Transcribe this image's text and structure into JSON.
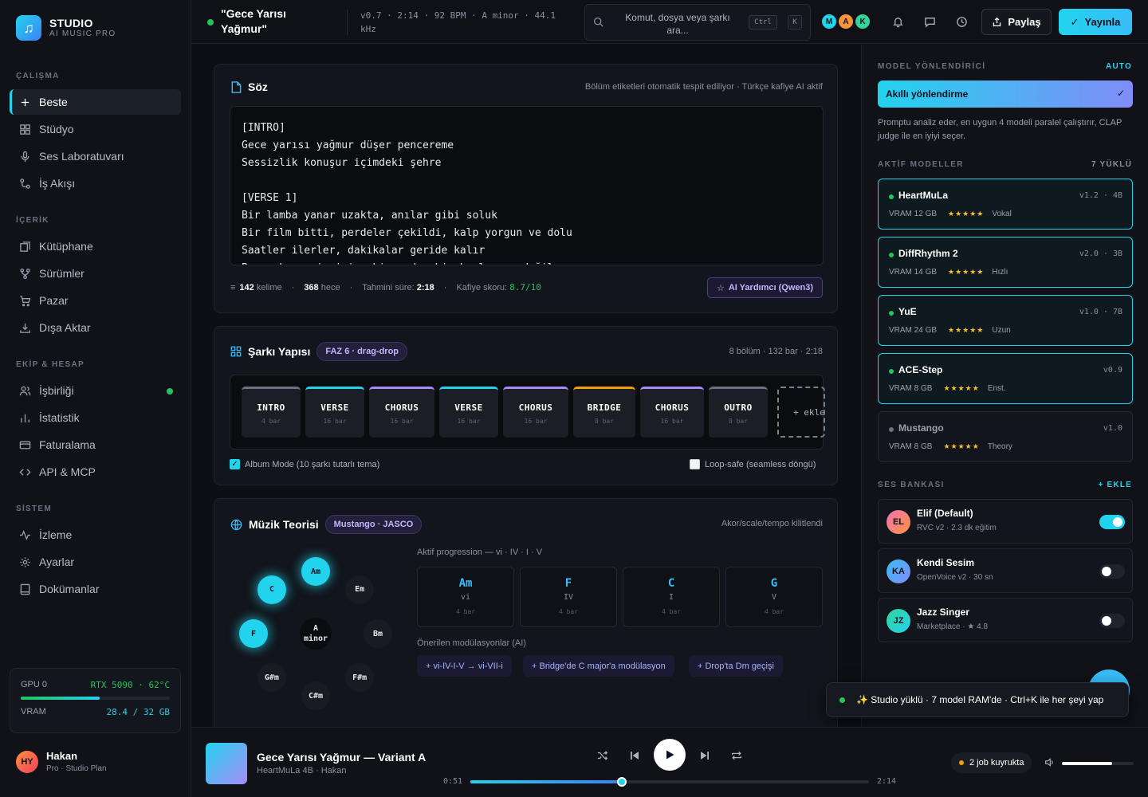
{
  "brand": {
    "name": "STUDIO",
    "tagline": "AI MUSIC PRO",
    "logo_icon": "music-note-icon",
    "accent": "#22d3ee"
  },
  "sidebar": {
    "sections": [
      {
        "title": "ÇALIŞMA",
        "items": [
          {
            "label": "Beste",
            "icon": "plus-icon",
            "active": true
          },
          {
            "label": "Stüdyo",
            "icon": "grid-icon"
          },
          {
            "label": "Ses Laboratuvarı",
            "icon": "microphone-icon"
          },
          {
            "label": "İş Akışı",
            "icon": "workflow-icon"
          }
        ]
      },
      {
        "title": "İÇERİK",
        "items": [
          {
            "label": "Kütüphane",
            "icon": "library-icon"
          },
          {
            "label": "Sürümler",
            "icon": "branch-icon"
          },
          {
            "label": "Pazar",
            "icon": "cart-icon"
          },
          {
            "label": "Dışa Aktar",
            "icon": "download-icon"
          }
        ]
      },
      {
        "title": "EKİP & HESAP",
        "items": [
          {
            "label": "İşbirliği",
            "icon": "users-icon",
            "online": true
          },
          {
            "label": "İstatistik",
            "icon": "bar-chart-icon"
          },
          {
            "label": "Faturalama",
            "icon": "card-icon"
          },
          {
            "label": "API & MCP",
            "icon": "code-icon"
          }
        ]
      },
      {
        "title": "SİSTEM",
        "items": [
          {
            "label": "İzleme",
            "icon": "activity-icon"
          },
          {
            "label": "Ayarlar",
            "icon": "gear-icon"
          },
          {
            "label": "Dokümanlar",
            "icon": "book-icon"
          }
        ]
      }
    ],
    "gpu": {
      "label": "GPU 0",
      "model": "RTX 5090 · 62°C",
      "load": 0.53,
      "vram_label": "VRAM",
      "vram": "28.4 / 32 GB"
    },
    "user": {
      "initials": "HY",
      "name": "Hakan",
      "plan": "Pro · Studio Plan"
    }
  },
  "header": {
    "title": "\"Gece Yarısı Yağmur\"",
    "meta": "v0.7 · 2:14 · 92 BPM · A minor · 44.1 kHz",
    "search_placeholder": "Komut, dosya veya şarkı ara...",
    "kbd1": "Ctrl",
    "kbd2": "K",
    "collaborators": [
      {
        "initial": "M",
        "color": "#22d3ee"
      },
      {
        "initial": "A",
        "color": "#fb923c"
      },
      {
        "initial": "K",
        "color": "#34d399"
      }
    ],
    "share_label": "Paylaş",
    "publish_label": "Yayınla"
  },
  "lyrics": {
    "title": "Söz",
    "hint": "Bölüm etiketleri otomatik tespit ediliyor · Türkçe kafiye AI aktif",
    "lines": [
      "[INTRO]",
      "Gece yarısı yağmur düşer pencereme",
      "Sessizlik konuşur içimdeki şehre",
      "",
      "[VERSE 1]",
      "Bir lamba yanar uzakta, anılar gibi soluk",
      "Bir film bitti, perdeler çekildi, kalp yorgun ve dolu",
      "Saatler ilerler, dakikalar geride kalır",
      "Bu şarkı senin için, bir veda, bir başlangıç değil"
    ],
    "words": "142",
    "words_label": "kelime",
    "syllables": "368",
    "syllables_label": "hece",
    "duration_label": "Tahmini süre:",
    "duration": "2:18",
    "rhyme_label": "Kafiye skoru:",
    "rhyme": "8.7/10",
    "ai_button": "AI Yardımcı (Qwen3)"
  },
  "structure": {
    "title": "Şarkı Yapısı",
    "badge": "FAZ 6 · drag-drop",
    "summary": "8 bölüm · 132 bar · 2:18",
    "sections": [
      {
        "name": "INTRO",
        "bars": "4 bar",
        "color": "#6b7180"
      },
      {
        "name": "VERSE",
        "bars": "16 bar",
        "color": "#22d3ee"
      },
      {
        "name": "CHORUS",
        "bars": "16 bar",
        "color": "#a78bfa"
      },
      {
        "name": "VERSE",
        "bars": "16 bar",
        "color": "#22d3ee"
      },
      {
        "name": "CHORUS",
        "bars": "16 bar",
        "color": "#a78bfa"
      },
      {
        "name": "BRIDGE",
        "bars": "8 bar",
        "color": "#f59e0b"
      },
      {
        "name": "CHORUS",
        "bars": "16 bar",
        "color": "#a78bfa"
      },
      {
        "name": "OUTRO",
        "bars": "8 bar",
        "color": "#6b7180"
      }
    ],
    "add_label": "+ ekle",
    "album_mode": "Album Mode (10 şarkı tutarlı tema)",
    "loop_safe": "Loop-safe (seamless döngü)"
  },
  "theory": {
    "title": "Müzik Teorisi",
    "badge": "Mustango · JASCO",
    "hint": "Akor/scale/tempo kilitlendi",
    "wheel": [
      {
        "label": "Am",
        "hot": true
      },
      {
        "label": "Em",
        "hot": false
      },
      {
        "label": "Bm",
        "hot": false
      },
      {
        "label": "F#m",
        "hot": false
      },
      {
        "label": "C#m",
        "hot": false
      },
      {
        "label": "G#m",
        "hot": false
      },
      {
        "label": "F",
        "hot": true
      },
      {
        "label": "C",
        "hot": true
      }
    ],
    "center": "A minor",
    "progression_label": "Aktif progression — vi · IV · I · V",
    "progression": [
      {
        "chord": "Am",
        "roman": "vi",
        "bars": "4 bar"
      },
      {
        "chord": "F",
        "roman": "IV",
        "bars": "4 bar"
      },
      {
        "chord": "C",
        "roman": "I",
        "bars": "4 bar"
      },
      {
        "chord": "G",
        "roman": "V",
        "bars": "4 bar"
      }
    ],
    "modulation_label": "Önerilen modülasyonlar (AI)",
    "modulations": [
      "+ vi-IV-I-V → vi-VII-i",
      "+ Bridge'de C major'a modülasyon",
      "+ Drop'ta Dm geçişi"
    ]
  },
  "right": {
    "router_label": "MODEL YÖNLENDİRİCİ",
    "router_mode": "AUTO",
    "router_button": "Akıllı yönlendirme",
    "router_desc": "Promptu analiz eder, en uygun 4 modeli paralel çalıştırır, CLAP judge ile en iyiyi seçer.",
    "models_label": "AKTİF MODELLER",
    "models_count": "7 YÜKLÜ",
    "models": [
      {
        "name": "HeartMuLa",
        "version": "v1.2 · 4B",
        "vram": "VRAM 12 GB",
        "stars": "★★★★★",
        "tag": "Vokal",
        "active": true
      },
      {
        "name": "DiffRhythm 2",
        "version": "v2.0 · 3B",
        "vram": "VRAM 14 GB",
        "stars": "★★★★★",
        "tag": "Hızlı",
        "active": true
      },
      {
        "name": "YuE",
        "version": "v1.0 · 7B",
        "vram": "VRAM 24 GB",
        "stars": "★★★★★",
        "tag": "Uzun",
        "active": true
      },
      {
        "name": "ACE-Step",
        "version": "v0.9",
        "vram": "VRAM 8 GB",
        "stars": "★★★★★",
        "tag": "Enst.",
        "active": true
      },
      {
        "name": "Mustango",
        "version": "v1.0",
        "vram": "VRAM 8 GB",
        "stars": "★★★★★",
        "tag": "Theory",
        "active": false
      }
    ],
    "voice_label": "SES BANKASI",
    "voice_add": "+ EKLE",
    "voices": [
      {
        "initials": "EL",
        "name": "Elif (Default)",
        "sub": "RVC v2 · 2.3 dk eğitim",
        "on": true,
        "color": "linear-gradient(135deg,#f472b6,#fb923c)"
      },
      {
        "initials": "KA",
        "name": "Kendi Sesim",
        "sub": "OpenVoice v2 · 30 sn",
        "on": false,
        "color": "linear-gradient(135deg,#38bdf8,#818cf8)"
      },
      {
        "initials": "JZ",
        "name": "Jazz Singer",
        "sub": "Marketplace · ★ 4.8",
        "on": false,
        "color": "linear-gradient(135deg,#34d399,#22d3ee)"
      }
    ]
  },
  "toast": "✨ Studio yüklü · 7 model RAM'de · Ctrl+K ile her şeyi yap",
  "player": {
    "title": "Gece Yarısı Yağmur — Variant A",
    "subtitle": "HeartMuLa 4B · Hakan",
    "current": "0:51",
    "total": "2:14",
    "progress": 0.38,
    "queue": "2 job kuyrukta",
    "volume": 0.7
  }
}
